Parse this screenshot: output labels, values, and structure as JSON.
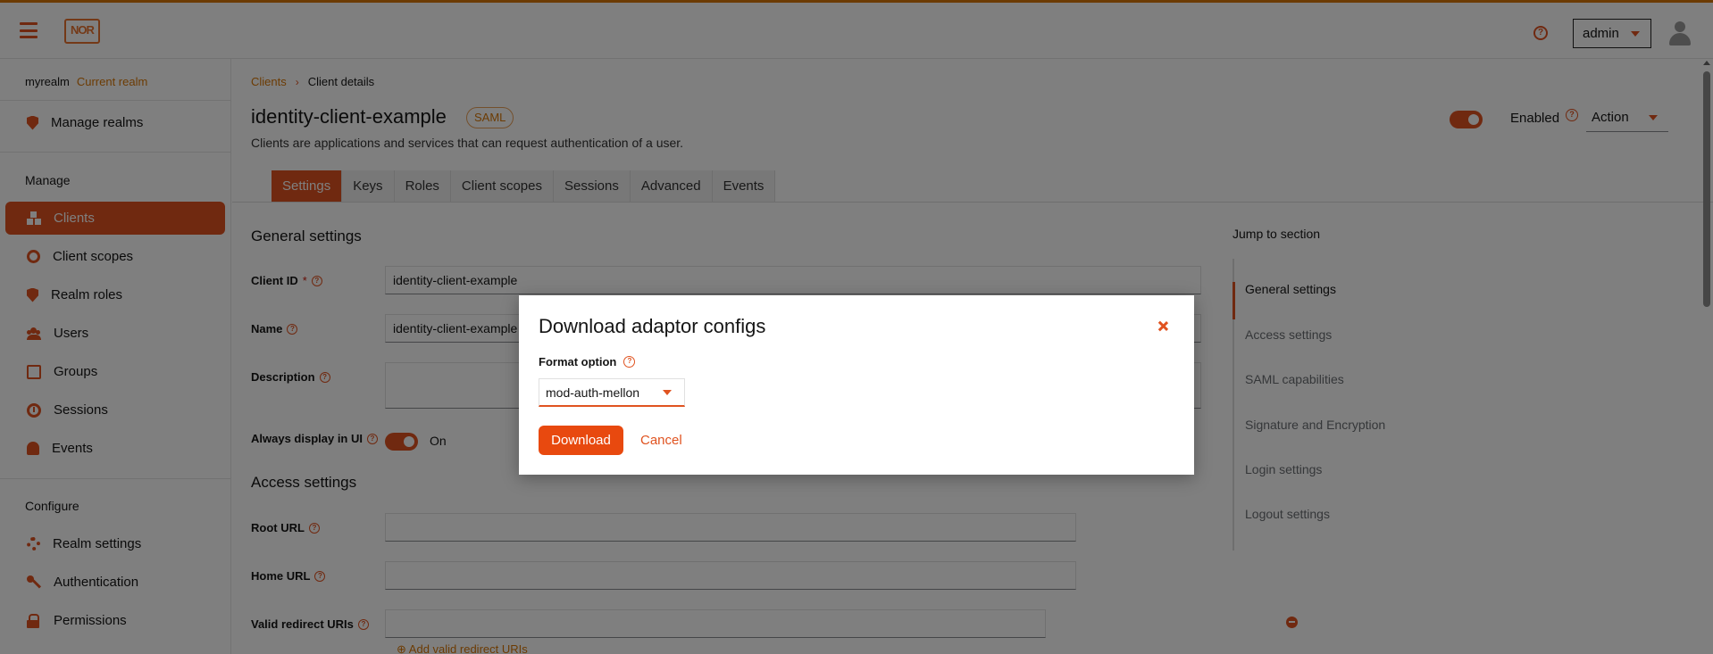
{
  "header": {
    "logo_text": "NOR",
    "user": "admin"
  },
  "sidebar": {
    "realm": "myrealm",
    "realm_tag": "Current realm",
    "manage_realms": "Manage realms",
    "manage_label": "Manage",
    "configure_label": "Configure",
    "items": [
      {
        "label": "Clients",
        "icon": "cubes-icon",
        "active": true
      },
      {
        "label": "Client scopes",
        "icon": "ring-icon"
      },
      {
        "label": "Realm roles",
        "icon": "shield-icon"
      },
      {
        "label": "Users",
        "icon": "users-icon"
      },
      {
        "label": "Groups",
        "icon": "groups-icon"
      },
      {
        "label": "Sessions",
        "icon": "clock-icon"
      },
      {
        "label": "Events",
        "icon": "bell-icon"
      }
    ],
    "config_items": [
      {
        "label": "Realm settings",
        "icon": "gear-icon"
      },
      {
        "label": "Authentication",
        "icon": "key-icon"
      },
      {
        "label": "Permissions",
        "icon": "lock-icon"
      }
    ]
  },
  "breadcrumb": {
    "parent": "Clients",
    "current": "Client details"
  },
  "client": {
    "title": "identity-client-example",
    "badge": "SAML",
    "description": "Clients are applications and services that can request authentication of a user.",
    "enabled_label": "Enabled",
    "action_label": "Action"
  },
  "tabs": [
    "Settings",
    "Keys",
    "Roles",
    "Client scopes",
    "Sessions",
    "Advanced",
    "Events"
  ],
  "form": {
    "general_heading": "General settings",
    "client_id_label": "Client ID",
    "client_id_required": "*",
    "client_id_value": "identity-client-example",
    "name_label": "Name",
    "name_value": "identity-client-example",
    "description_label": "Description",
    "always_display_label": "Always display in UI",
    "always_display_value": "On",
    "access_heading": "Access settings",
    "root_url_label": "Root URL",
    "home_url_label": "Home URL",
    "redirect_label": "Valid redirect URIs",
    "add_redirect": "Add valid redirect URIs"
  },
  "jump": {
    "title": "Jump to section",
    "items": [
      "General settings",
      "Access settings",
      "SAML capabilities",
      "Signature and Encryption",
      "Login settings",
      "Logout settings"
    ]
  },
  "modal": {
    "title": "Download adaptor configs",
    "format_label": "Format option",
    "format_value": "mod-auth-mellon",
    "download_label": "Download",
    "cancel_label": "Cancel"
  },
  "colors": {
    "accent": "#e05320",
    "accent_text": "#d97706",
    "top_border": "#d97706"
  }
}
